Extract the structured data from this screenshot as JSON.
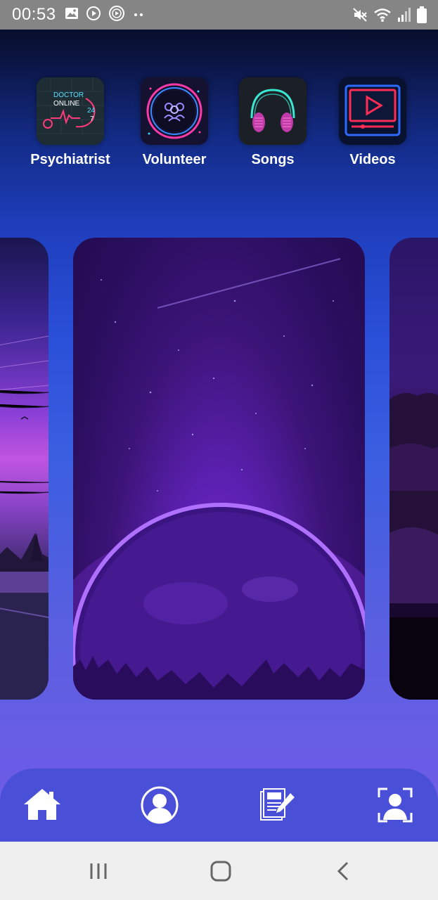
{
  "status_bar": {
    "time": "00:53",
    "left_icons": [
      "image-icon",
      "play-circle-icon",
      "media-icon",
      "more-dots-icon"
    ],
    "right_icons": [
      "mute-icon",
      "wifi-icon",
      "signal-icon",
      "battery-icon"
    ]
  },
  "apps": [
    {
      "label": "Psychiatrist",
      "icon": "doctor-online-icon",
      "accent": "#ff3a7a"
    },
    {
      "label": "Volunteer",
      "icon": "volunteer-group-icon",
      "accent": "#ff3aa8"
    },
    {
      "label": "Songs",
      "icon": "headphones-icon",
      "accent": "#3ae6d0"
    },
    {
      "label": "Videos",
      "icon": "video-play-icon",
      "accent": "#ff2d55"
    }
  ],
  "carousel": {
    "cards": [
      "sunset-landscape-card",
      "purple-planet-card",
      "purple-clouds-card"
    ]
  },
  "bottom_nav": {
    "items": [
      "home-icon",
      "profile-icon",
      "notes-edit-icon",
      "face-scan-icon"
    ],
    "background": "#4a4fd8"
  },
  "system_nav": {
    "buttons": [
      "recents-button",
      "home-button",
      "back-button"
    ]
  },
  "colors": {
    "status_bar": "#858585",
    "nav_bar": "#4a4fd8",
    "system_nav": "#efefef"
  }
}
